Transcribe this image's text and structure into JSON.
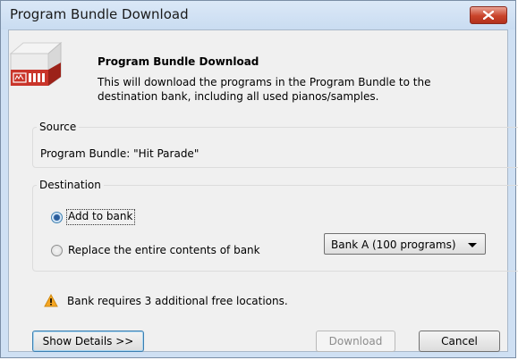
{
  "window": {
    "title": "Program Bundle Download"
  },
  "header": {
    "title": "Program Bundle Download",
    "description": "This will download the programs in the Program Bundle to the destination bank, including all used pianos/samples."
  },
  "source": {
    "label": "Source",
    "text": "Program Bundle: \"Hit Parade\""
  },
  "destination": {
    "label": "Destination",
    "options": [
      {
        "label": "Add to bank",
        "selected": true
      },
      {
        "label": "Replace the entire contents of bank",
        "selected": false
      }
    ],
    "bank_select": {
      "value": "Bank A (100 programs)"
    }
  },
  "warning": {
    "text": "Bank requires 3 additional free locations.",
    "icon": "warning-icon",
    "color": "#f5a623"
  },
  "buttons": {
    "show_details": "Show Details >>",
    "download": "Download",
    "cancel": "Cancel"
  },
  "colors": {
    "close_button": "#c9432a",
    "app_icon_red": "#c9352a"
  }
}
